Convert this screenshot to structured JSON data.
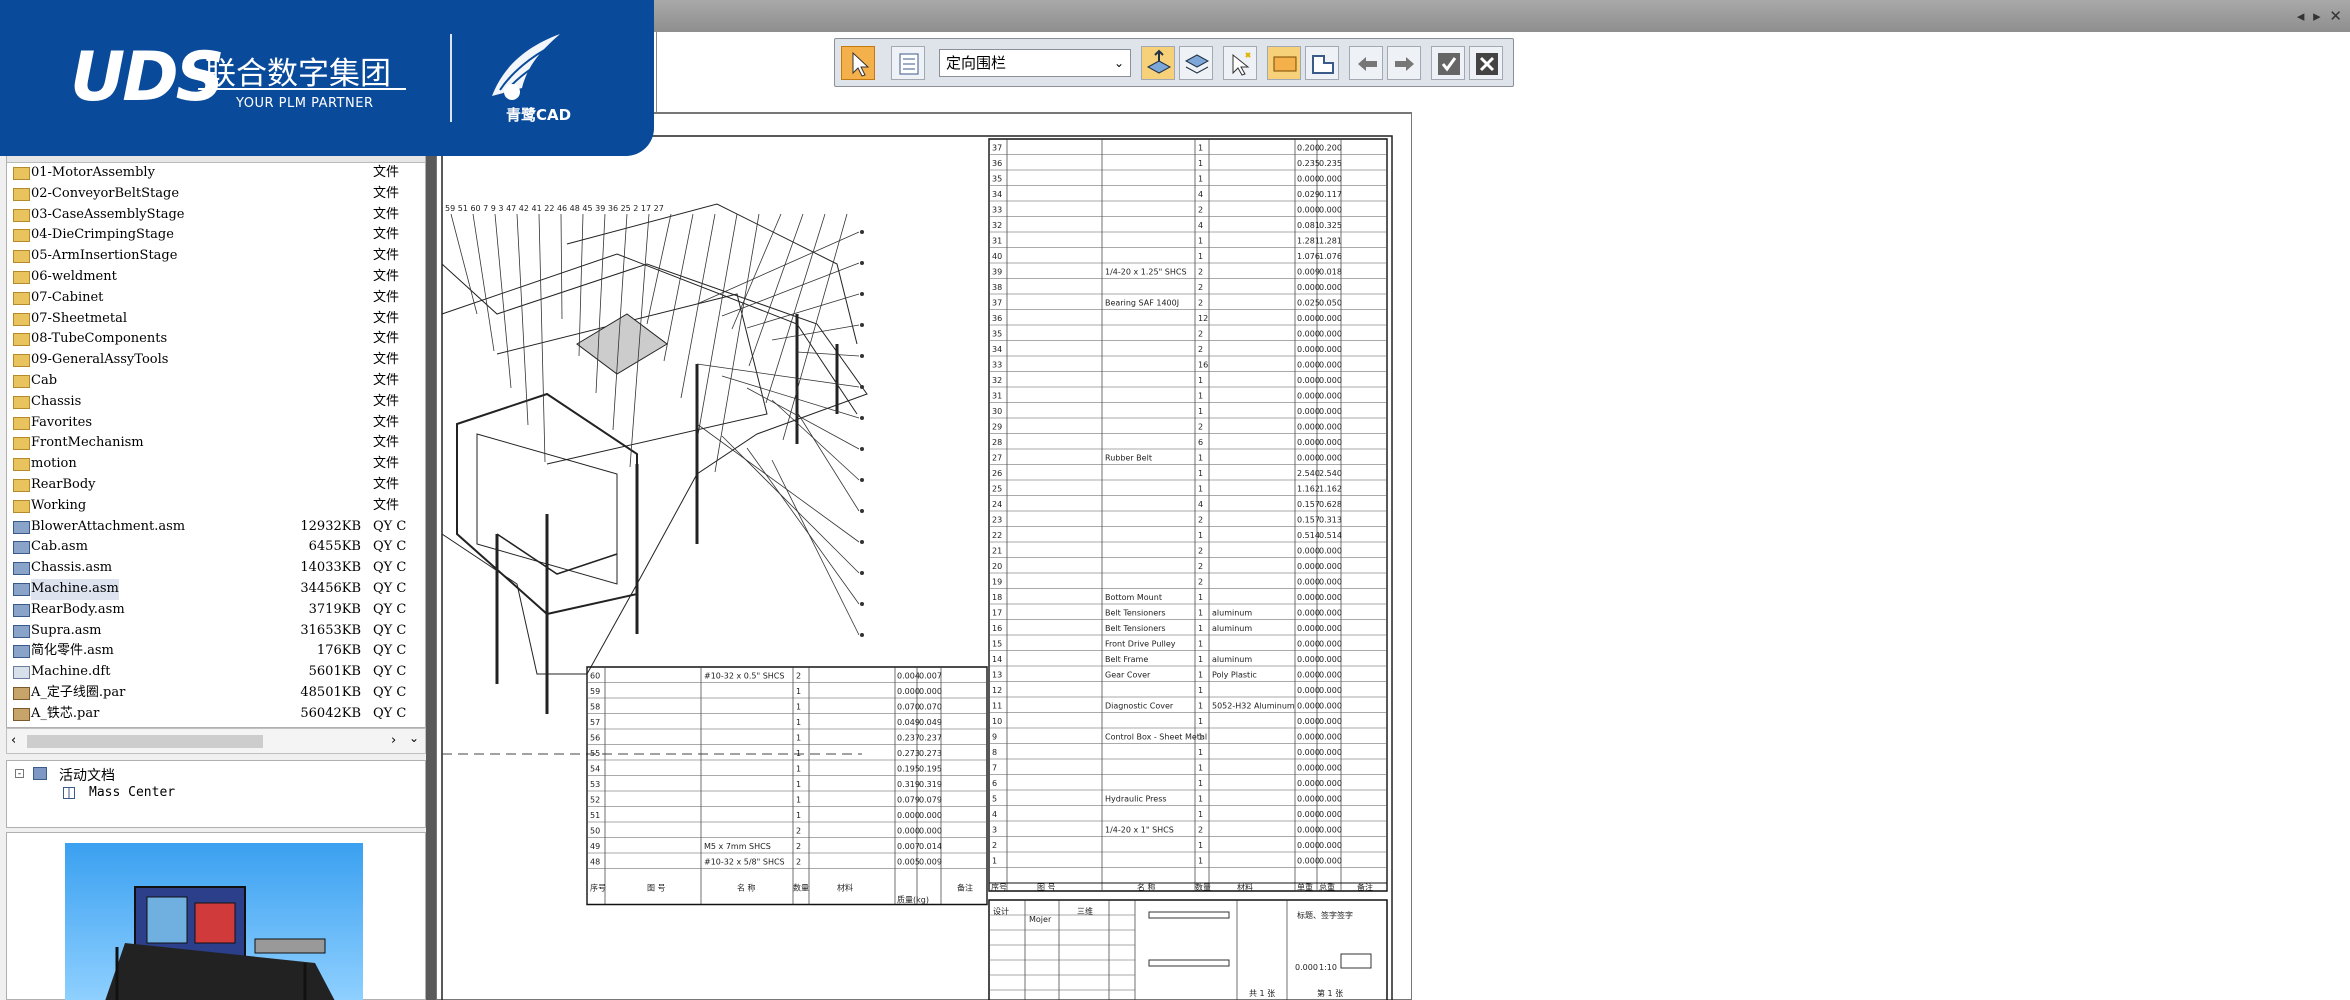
{
  "brand": {
    "logo_text": "UDS",
    "cn_name": "联合数字集团",
    "tagline": "YOUR PLM PARTNER",
    "product": "青鹭CAD"
  },
  "window_controls": {
    "text": "◂ ▸ ✕"
  },
  "toolbar": {
    "dropdown_value": "定向围栏"
  },
  "file_list": {
    "items": [
      {
        "name": "01-MotorAssembly",
        "size": "",
        "type": "文件",
        "icon": "folder-icon"
      },
      {
        "name": "02-ConveyorBeltStage",
        "size": "",
        "type": "文件",
        "icon": "folder-icon"
      },
      {
        "name": "03-CaseAssemblyStage",
        "size": "",
        "type": "文件",
        "icon": "folder-icon"
      },
      {
        "name": "04-DieCrimpingStage",
        "size": "",
        "type": "文件",
        "icon": "folder-icon"
      },
      {
        "name": "05-ArmInsertionStage",
        "size": "",
        "type": "文件",
        "icon": "folder-icon"
      },
      {
        "name": "06-weldment",
        "size": "",
        "type": "文件",
        "icon": "folder-icon"
      },
      {
        "name": "07-Cabinet",
        "size": "",
        "type": "文件",
        "icon": "folder-icon"
      },
      {
        "name": "07-Sheetmetal",
        "size": "",
        "type": "文件",
        "icon": "folder-icon"
      },
      {
        "name": "08-TubeComponents",
        "size": "",
        "type": "文件",
        "icon": "folder-icon"
      },
      {
        "name": "09-GeneralAssyTools",
        "size": "",
        "type": "文件",
        "icon": "folder-icon"
      },
      {
        "name": "Cab",
        "size": "",
        "type": "文件",
        "icon": "folder-icon"
      },
      {
        "name": "Chassis",
        "size": "",
        "type": "文件",
        "icon": "folder-icon"
      },
      {
        "name": "Favorites",
        "size": "",
        "type": "文件",
        "icon": "folder-icon"
      },
      {
        "name": "FrontMechanism",
        "size": "",
        "type": "文件",
        "icon": "folder-icon"
      },
      {
        "name": "motion",
        "size": "",
        "type": "文件",
        "icon": "folder-icon"
      },
      {
        "name": "RearBody",
        "size": "",
        "type": "文件",
        "icon": "folder-icon"
      },
      {
        "name": "Working",
        "size": "",
        "type": "文件",
        "icon": "folder-icon"
      },
      {
        "name": "BlowerAttachment.asm",
        "size": "12932KB",
        "type": "QY C",
        "icon": "assembly-icon"
      },
      {
        "name": "Cab.asm",
        "size": "6455KB",
        "type": "QY C",
        "icon": "assembly-icon"
      },
      {
        "name": "Chassis.asm",
        "size": "14033KB",
        "type": "QY C",
        "icon": "assembly-icon"
      },
      {
        "name": "Machine.asm",
        "size": "34456KB",
        "type": "QY C",
        "icon": "assembly-icon",
        "selected": true
      },
      {
        "name": "RearBody.asm",
        "size": "3719KB",
        "type": "QY C",
        "icon": "assembly-icon"
      },
      {
        "name": "Supra.asm",
        "size": "31653KB",
        "type": "QY C",
        "icon": "assembly-icon"
      },
      {
        "name": "简化零件.asm",
        "size": "176KB",
        "type": "QY C",
        "icon": "assembly-icon"
      },
      {
        "name": "Machine.dft",
        "size": "5601KB",
        "type": "QY C",
        "icon": "draft-icon"
      },
      {
        "name": "A_定子线圈.par",
        "size": "48501KB",
        "type": "QY C",
        "icon": "part-icon"
      },
      {
        "name": "A_铁芯.par",
        "size": "56042KB",
        "type": "QY C",
        "icon": "part-icon"
      }
    ]
  },
  "tree": {
    "root": "活动文档",
    "child": "Mass Center"
  },
  "drawing": {
    "balloons": "59 51 60 7 9 3 47 42 41 22 46 48 45 39 36 25 2 17 27",
    "bom_right": [
      {
        "no": "37",
        "name": "",
        "qty": "1",
        "a": "0.200",
        "b": "0.200"
      },
      {
        "no": "36",
        "name": "",
        "qty": "1",
        "a": "0.235",
        "b": "0.235"
      },
      {
        "no": "35",
        "name": "",
        "qty": "1",
        "a": "0.000",
        "b": "0.000"
      },
      {
        "no": "34",
        "name": "",
        "qty": "4",
        "a": "0.029",
        "b": "0.117"
      },
      {
        "no": "33",
        "name": "",
        "qty": "2",
        "a": "0.000",
        "b": "0.000"
      },
      {
        "no": "32",
        "name": "",
        "qty": "4",
        "a": "0.081",
        "b": "0.325"
      },
      {
        "no": "31",
        "name": "",
        "qty": "1",
        "a": "1.281",
        "b": "1.281"
      },
      {
        "no": "40",
        "name": "",
        "qty": "1",
        "a": "1.076",
        "b": "1.076"
      },
      {
        "no": "39",
        "name": "1/4-20 x 1.25\" SHCS",
        "qty": "2",
        "a": "0.009",
        "b": "0.018"
      },
      {
        "no": "38",
        "name": "",
        "qty": "2",
        "a": "0.000",
        "b": "0.000"
      },
      {
        "no": "37",
        "name": "Bearing SAF 1400J",
        "qty": "2",
        "a": "0.025",
        "b": "0.050"
      },
      {
        "no": "36",
        "name": "",
        "qty": "12",
        "a": "0.000",
        "b": "0.000"
      },
      {
        "no": "35",
        "name": "",
        "qty": "2",
        "a": "0.000",
        "b": "0.000"
      },
      {
        "no": "34",
        "name": "",
        "qty": "2",
        "a": "0.000",
        "b": "0.000"
      },
      {
        "no": "33",
        "name": "",
        "qty": "16",
        "a": "0.000",
        "b": "0.000"
      },
      {
        "no": "32",
        "name": "",
        "qty": "1",
        "a": "0.000",
        "b": "0.000"
      },
      {
        "no": "31",
        "name": "",
        "qty": "1",
        "a": "0.000",
        "b": "0.000"
      },
      {
        "no": "30",
        "name": "",
        "qty": "1",
        "a": "0.000",
        "b": "0.000"
      },
      {
        "no": "29",
        "name": "",
        "qty": "2",
        "a": "0.000",
        "b": "0.000"
      },
      {
        "no": "28",
        "name": "",
        "qty": "6",
        "a": "0.000",
        "b": "0.000"
      },
      {
        "no": "27",
        "name": "Rubber Belt",
        "qty": "1",
        "a": "0.000",
        "b": "0.000"
      },
      {
        "no": "26",
        "name": "",
        "qty": "1",
        "a": "2.540",
        "b": "2.540"
      },
      {
        "no": "25",
        "name": "",
        "qty": "1",
        "a": "1.162",
        "b": "1.162"
      },
      {
        "no": "24",
        "name": "",
        "qty": "4",
        "a": "0.157",
        "b": "0.628"
      },
      {
        "no": "23",
        "name": "",
        "qty": "2",
        "a": "0.157",
        "b": "0.313"
      },
      {
        "no": "22",
        "name": "",
        "qty": "1",
        "a": "0.514",
        "b": "0.514"
      },
      {
        "no": "21",
        "name": "",
        "qty": "2",
        "a": "0.000",
        "b": "0.000"
      },
      {
        "no": "20",
        "name": "",
        "qty": "2",
        "a": "0.000",
        "b": "0.000"
      },
      {
        "no": "19",
        "name": "",
        "qty": "2",
        "a": "0.000",
        "b": "0.000"
      },
      {
        "no": "18",
        "name": "Bottom Mount",
        "qty": "1",
        "a": "0.000",
        "b": "0.000"
      },
      {
        "no": "17",
        "name": "Belt Tensioners",
        "qty": "1",
        "a": "0.000",
        "b": "0.000",
        "mat": "aluminum"
      },
      {
        "no": "16",
        "name": "Belt Tensioners",
        "qty": "1",
        "a": "0.000",
        "b": "0.000",
        "mat": "aluminum"
      },
      {
        "no": "15",
        "name": "Front Drive Pulley",
        "qty": "1",
        "a": "0.000",
        "b": "0.000"
      },
      {
        "no": "14",
        "name": "Belt Frame",
        "qty": "1",
        "a": "0.000",
        "b": "0.000",
        "mat": "aluminum"
      },
      {
        "no": "13",
        "name": "Gear Cover",
        "qty": "1",
        "a": "0.000",
        "b": "0.000",
        "mat": "Poly Plastic"
      },
      {
        "no": "12",
        "name": "",
        "qty": "1",
        "a": "0.000",
        "b": "0.000"
      },
      {
        "no": "11",
        "name": "Diagnostic Cover",
        "qty": "1",
        "a": "0.000",
        "b": "0.000",
        "mat": "5052-H32 Aluminum"
      },
      {
        "no": "10",
        "name": "",
        "qty": "1",
        "a": "0.000",
        "b": "0.000"
      },
      {
        "no": "9",
        "name": "Control Box - Sheet Metal",
        "qty": "1",
        "a": "0.000",
        "b": "0.000"
      },
      {
        "no": "8",
        "name": "",
        "qty": "1",
        "a": "0.000",
        "b": "0.000"
      },
      {
        "no": "7",
        "name": "",
        "qty": "1",
        "a": "0.000",
        "b": "0.000"
      },
      {
        "no": "6",
        "name": "",
        "qty": "1",
        "a": "0.000",
        "b": "0.000"
      },
      {
        "no": "5",
        "name": "Hydraulic Press",
        "qty": "1",
        "a": "0.000",
        "b": "0.000"
      },
      {
        "no": "4",
        "name": "",
        "qty": "1",
        "a": "0.000",
        "b": "0.000"
      },
      {
        "no": "3",
        "name": "1/4-20 x 1\" SHCS",
        "qty": "2",
        "a": "0.000",
        "b": "0.000"
      },
      {
        "no": "2",
        "name": "",
        "qty": "1",
        "a": "0.000",
        "b": "0.000"
      },
      {
        "no": "1",
        "name": "",
        "qty": "1",
        "a": "0.000",
        "b": "0.000"
      }
    ],
    "bom_left": [
      {
        "no": "60",
        "name": "#10-32 x 0.5\" SHCS",
        "qty": "2",
        "a": "0.004",
        "b": "0.007"
      },
      {
        "no": "59",
        "name": "",
        "qty": "1",
        "a": "0.000",
        "b": "0.000"
      },
      {
        "no": "58",
        "name": "",
        "qty": "1",
        "a": "0.070",
        "b": "0.070"
      },
      {
        "no": "57",
        "name": "",
        "qty": "1",
        "a": "0.049",
        "b": "0.049"
      },
      {
        "no": "56",
        "name": "",
        "qty": "1",
        "a": "0.237",
        "b": "0.237"
      },
      {
        "no": "55",
        "name": "",
        "qty": "1",
        "a": "0.273",
        "b": "0.273"
      },
      {
        "no": "54",
        "name": "",
        "qty": "1",
        "a": "0.195",
        "b": "0.195"
      },
      {
        "no": "53",
        "name": "",
        "qty": "1",
        "a": "0.319",
        "b": "0.319"
      },
      {
        "no": "52",
        "name": "",
        "qty": "1",
        "a": "0.079",
        "b": "0.079"
      },
      {
        "no": "51",
        "name": "",
        "qty": "1",
        "a": "0.000",
        "b": "0.000"
      },
      {
        "no": "50",
        "name": "",
        "qty": "2",
        "a": "0.000",
        "b": "0.000"
      },
      {
        "no": "49",
        "name": "M5 x 7mm SHCS",
        "qty": "2",
        "a": "0.007",
        "b": "0.014"
      },
      {
        "no": "48",
        "name": "#10-32 x 5/8\" SHCS",
        "qty": "2",
        "a": "0.005",
        "b": "0.009"
      }
    ],
    "header_labels": {
      "no": "序号",
      "code": "图 号",
      "name": "名 称",
      "qty": "数量",
      "mat": "材料",
      "weight": "质量(kg)",
      "note": "备注",
      "unit": "单重",
      "total": "总重"
    },
    "title_block": {
      "design": "设计",
      "designer": "Mojer",
      "tab3": "三维",
      "part_title": "标题、签字签字",
      "scale": "1:10",
      "mass": "0.000",
      "sheet": "第 1 张",
      "total_sheets": "共 1 张"
    }
  }
}
